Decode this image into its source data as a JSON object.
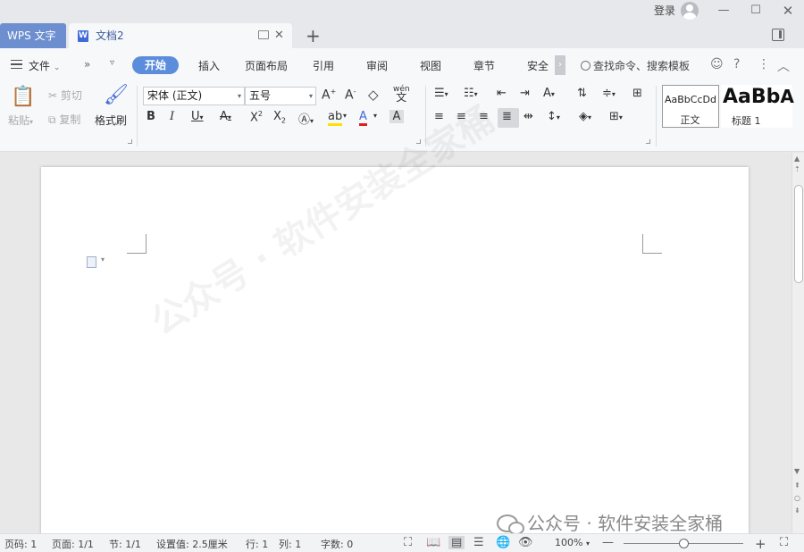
{
  "titlebar": {
    "app_tab": "WPS 文字",
    "doc_tab": "文档2",
    "login": "登录",
    "new_tab": "+"
  },
  "menu": {
    "file": "文件",
    "tabs": [
      "开始",
      "插入",
      "页面布局",
      "引用",
      "审阅",
      "视图",
      "章节",
      "安全"
    ],
    "search": "查找命令、搜索模板"
  },
  "ribbon": {
    "paste": "粘贴",
    "cut": "剪切",
    "copy": "复制",
    "format_painter": "格式刷",
    "font_name": "宋体 (正文)",
    "font_size": "五号",
    "styles": {
      "normal_preview": "AaBbCcDd",
      "normal_label": "正文",
      "heading_preview": "AaBb",
      "heading_extra": "A",
      "heading_label": "标题 1"
    },
    "phonetic_glyph": "wén"
  },
  "document": {
    "watermark": "公众号 · 软件安装全家桶"
  },
  "overlay": {
    "label": "公众号 · 软件安装全家桶"
  },
  "statusbar": {
    "page_num": "页码: 1",
    "page": "页面: 1/1",
    "section": "节: 1/1",
    "setting": "设置值: 2.5厘米",
    "row": "行: 1",
    "col": "列: 1",
    "word_count": "字数: 0",
    "zoom": "100%",
    "zoom_level": 1.0
  },
  "colors": {
    "accent": "#5c8ddd",
    "app_tab": "#6d8fd0",
    "highlight_yellow": "#ffe000",
    "font_color_red": "#e02020",
    "doc_icon_blue": "#3f6ad8"
  }
}
